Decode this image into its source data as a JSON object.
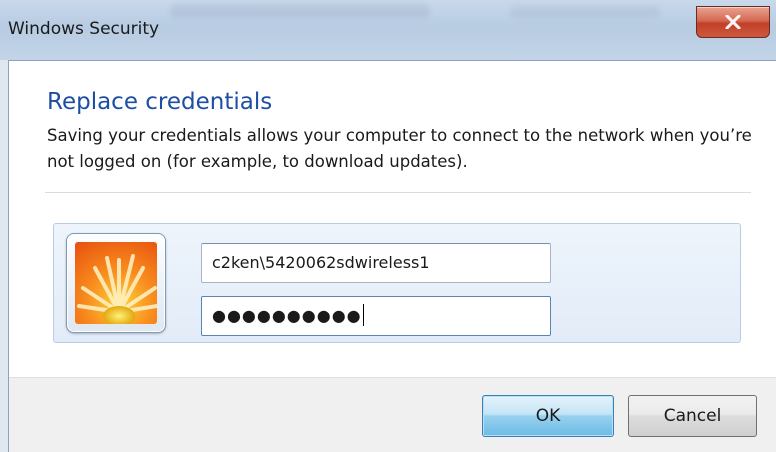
{
  "window": {
    "title": "Windows Security",
    "close_glyph": "close-icon"
  },
  "dialog": {
    "heading": "Replace credentials",
    "description": "Saving your credentials allows your computer to connect to the network when you’re not logged on (for example, to download updates)."
  },
  "credentials": {
    "avatar_icon": "user-avatar-flower",
    "username_value": "c2ken\\5420062sdwireless1",
    "password_value": "●●●●●●●●●●"
  },
  "buttons": {
    "ok_label": "OK",
    "cancel_label": "Cancel"
  },
  "colors": {
    "heading": "#1d4ea3",
    "close_button": "#c23f27",
    "ok_button_border": "#3c7fb1"
  }
}
